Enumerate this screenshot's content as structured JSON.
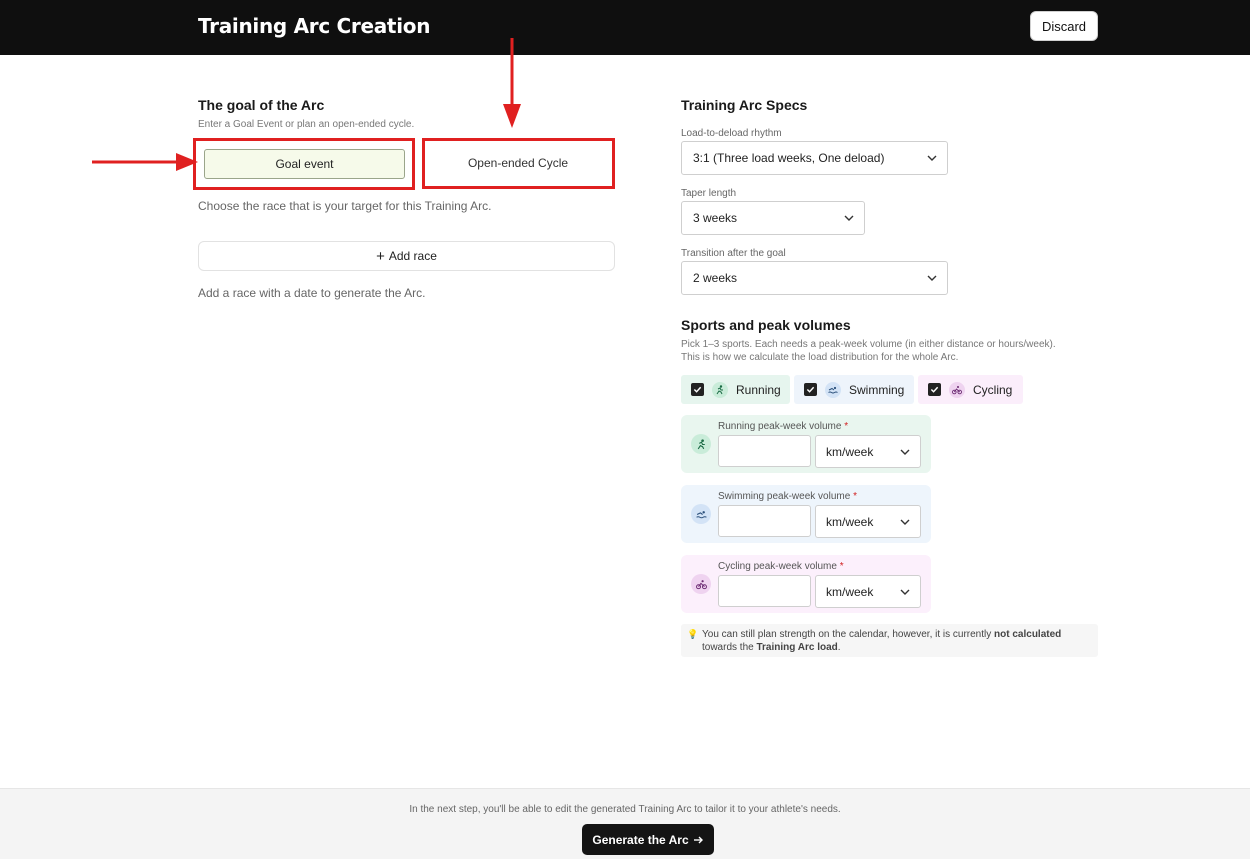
{
  "header": {
    "title": "Training Arc Creation",
    "discard_label": "Discard"
  },
  "goal": {
    "title": "The goal of the Arc",
    "subtitle": "Enter a Goal Event or plan an open-ended cycle.",
    "goal_event_label": "Goal event",
    "open_cycle_label": "Open-ended Cycle",
    "choose_text": "Choose the race that is your target for this Training Arc.",
    "add_race_label": "Add race",
    "add_race_hint": "Add a race with a date to generate the Arc."
  },
  "specs": {
    "title": "Training Arc Specs",
    "rhythm_label": "Load-to-deload rhythm",
    "rhythm_value": "3:1 (Three load weeks, One deload)",
    "taper_label": "Taper length",
    "taper_value": "3 weeks",
    "transition_label": "Transition after the goal",
    "transition_value": "2 weeks"
  },
  "sports": {
    "title": "Sports and peak volumes",
    "desc_line1": "Pick 1–3 sports. Each needs a peak-week volume (in either distance or hours/week).",
    "desc_line2": "This is how we calculate the load distribution for the whole Arc.",
    "chips": [
      {
        "label": "Running",
        "checked": true,
        "color": "#e6f5ee"
      },
      {
        "label": "Swimming",
        "checked": true,
        "color": "#eef4fb"
      },
      {
        "label": "Cycling",
        "checked": true,
        "color": "#fbeefb"
      }
    ],
    "volumes": [
      {
        "label": "Running peak-week volume",
        "required": "*",
        "value": "",
        "unit": "km/week",
        "color": "#e9f6ef"
      },
      {
        "label": "Swimming peak-week volume",
        "required": "*",
        "value": "",
        "unit": "km/week",
        "color": "#eef5fc"
      },
      {
        "label": "Cycling peak-week volume",
        "required": "*",
        "value": "",
        "unit": "km/week",
        "color": "#fcf0fc"
      }
    ],
    "tip_pre": "You can still plan strength on the calendar, however, it is currently ",
    "tip_bold": "not calculated",
    "tip_line2_pre": "towards the ",
    "tip_line2_bold": "Training Arc load",
    "tip_line2_post": "."
  },
  "footer": {
    "note": "In the next step, you'll be able to edit the generated Training Arc to tailor it to your athlete's needs.",
    "generate_label": "Generate the Arc"
  },
  "colors": {
    "annotation_red": "#e02020",
    "header_bg": "#0f0f0f"
  }
}
